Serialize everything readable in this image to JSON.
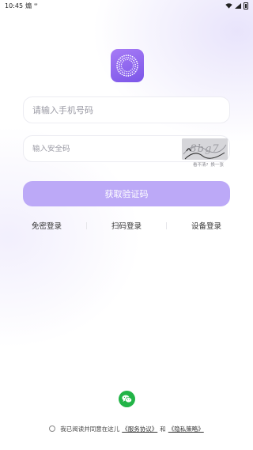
{
  "status_bar": {
    "time": "10:45",
    "notification_glyph_1": "煽",
    "notification_glyph_2": "ᵆ"
  },
  "logo": {
    "icon": "dotted-ring-logo",
    "color": "#8a63ee"
  },
  "login_form": {
    "phone": {
      "placeholder": "请输入手机号码",
      "value": ""
    },
    "security_code": {
      "placeholder": "输入安全码",
      "value": ""
    },
    "captcha": {
      "text": "8bg7",
      "hint_unclear": "看不清?",
      "hint_refresh": "换一张"
    },
    "submit_label": "获取验证码",
    "submit_color": "#bca9f7"
  },
  "login_options": [
    {
      "label": "免密登录"
    },
    {
      "label": "扫码登录"
    },
    {
      "label": "设备登录"
    }
  ],
  "wechat": {
    "icon": "wechat-icon",
    "color": "#22b447"
  },
  "agreement": {
    "prefix": "我已阅读并同意在这儿",
    "service_link": "《服务协议》",
    "conjunction": "和",
    "privacy_link": "《隐私策略》"
  }
}
